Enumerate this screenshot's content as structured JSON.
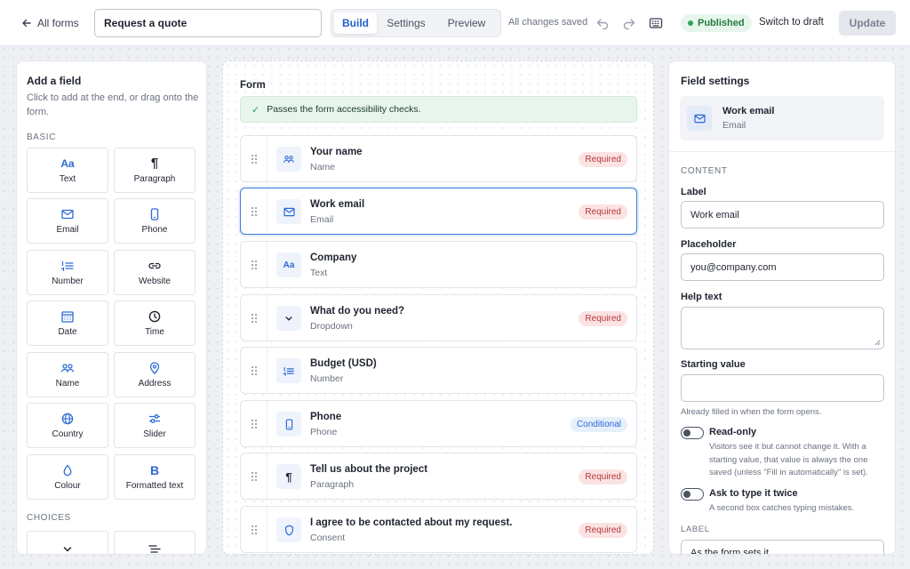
{
  "topbar": {
    "back_label": "All forms",
    "form_title": "Request a quote",
    "tabs": [
      {
        "label": "Build",
        "active": true
      },
      {
        "label": "Settings",
        "active": false
      },
      {
        "label": "Preview",
        "active": false
      }
    ],
    "save_status": "All changes saved",
    "status_badge": "Published",
    "switch_label": "Switch to draft",
    "update_label": "Update",
    "icons": [
      "undo-icon",
      "redo-icon",
      "keyboard-icon"
    ]
  },
  "add_field": {
    "title": "Add a field",
    "hint": "Click to add at the end, or drag onto the form.",
    "basic_label": "BASIC",
    "basic": [
      {
        "label": "Text",
        "icon": "text-icon",
        "glyph": "Aa"
      },
      {
        "label": "Paragraph",
        "icon": "paragraph-icon",
        "glyph": "¶"
      },
      {
        "label": "Email",
        "icon": "email-icon",
        "glyph": ""
      },
      {
        "label": "Phone",
        "icon": "phone-icon",
        "glyph": ""
      },
      {
        "label": "Number",
        "icon": "number-icon",
        "glyph": ""
      },
      {
        "label": "Website",
        "icon": "link-icon",
        "glyph": ""
      },
      {
        "label": "Date",
        "icon": "calendar-icon",
        "glyph": ""
      },
      {
        "label": "Time",
        "icon": "clock-icon",
        "glyph": ""
      },
      {
        "label": "Name",
        "icon": "people-icon",
        "glyph": ""
      },
      {
        "label": "Address",
        "icon": "location-pin-icon",
        "glyph": ""
      },
      {
        "label": "Country",
        "icon": "globe-icon",
        "glyph": ""
      },
      {
        "label": "Slider",
        "icon": "slider-icon",
        "glyph": ""
      },
      {
        "label": "Colour",
        "icon": "droplet-icon",
        "glyph": ""
      },
      {
        "label": "Formatted text",
        "icon": "bold-icon",
        "glyph": "B"
      }
    ],
    "choices_label": "CHOICES",
    "choices_icons": [
      "chevron-down-icon",
      "list-lines-icon"
    ]
  },
  "form": {
    "title": "Form",
    "banner": "Passes the form accessibility checks.",
    "fields": [
      {
        "label": "Your name",
        "type": "Name",
        "badge": "Required",
        "badge_kind": "required",
        "icon": "people-icon"
      },
      {
        "label": "Work email",
        "type": "Email",
        "badge": "Required",
        "badge_kind": "required",
        "icon": "email-icon",
        "selected": true
      },
      {
        "label": "Company",
        "type": "Text",
        "badge": "",
        "badge_kind": "",
        "icon": "text-icon"
      },
      {
        "label": "What do you need?",
        "type": "Dropdown",
        "badge": "Required",
        "badge_kind": "required",
        "icon": "chevron-down-icon"
      },
      {
        "label": "Budget (USD)",
        "type": "Number",
        "badge": "",
        "badge_kind": "",
        "icon": "number-icon"
      },
      {
        "label": "Phone",
        "type": "Phone",
        "badge": "Conditional",
        "badge_kind": "conditional",
        "icon": "phone-icon"
      },
      {
        "label": "Tell us about the project",
        "type": "Paragraph",
        "badge": "Required",
        "badge_kind": "required",
        "icon": "paragraph-icon"
      },
      {
        "label": "I agree to be contacted about my request.",
        "type": "Consent",
        "badge": "Required",
        "badge_kind": "required",
        "icon": "shield-icon"
      }
    ]
  },
  "settings": {
    "title": "Field settings",
    "selected_label": "Work email",
    "selected_type": "Email",
    "content_label": "CONTENT",
    "label_label": "Label",
    "label_value": "Work email",
    "placeholder_label": "Placeholder",
    "placeholder_value": "you@company.com",
    "help_label": "Help text",
    "help_value": "",
    "starting_label": "Starting value",
    "starting_value": "",
    "starting_help": "Already filled in when the form opens.",
    "readonly_label": "Read-only",
    "readonly_help": "Visitors see it but cannot change it. With a starting value, that value is always the one saved (unless \"Fill in automatically\" is set).",
    "twice_label": "Ask to type it twice",
    "twice_help": "A second box catches typing mistakes.",
    "label_section": "LABEL",
    "label_position": "As the form sets it"
  },
  "colors": {
    "accent": "#2d6ad6",
    "required_bg": "#fbe3e3",
    "required_text": "#b33a3a",
    "published_bg": "#e7f6ec",
    "published_text": "#237a42"
  }
}
